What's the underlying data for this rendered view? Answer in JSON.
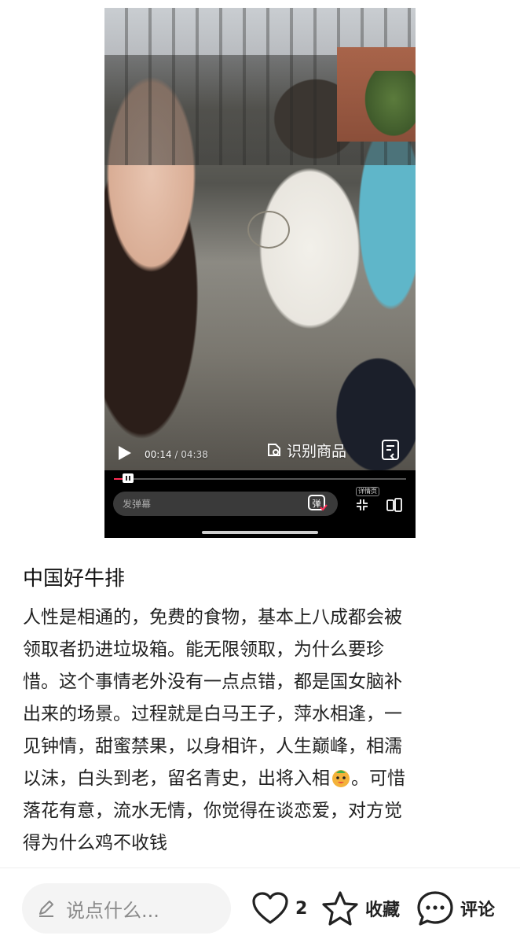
{
  "video": {
    "current_time": "00:14",
    "total_time": "/ 04:38",
    "progress": 0.05,
    "ocr_label": "识别商品",
    "danmu_placeholder": "发弹幕",
    "danmu_toggle_label": "弹",
    "detail_label": "详情页"
  },
  "post": {
    "title": "中国好牛排",
    "body_lines": [
      "人性是相通的，免费的食物，基本上八成都会被",
      "领取者扔进垃圾箱。能无限领取，为什么要珍",
      "惜。这个事情老外没有一点点错，都是国女脑补",
      "出来的场景。过程就是白马王子，萍水相逢，一",
      "见钟情，甜蜜禁果，以身相许，人生巅峰，相濡",
      "以沫，白头到老，留名青史，出将入相",
      "落花有意，流水无情，你觉得在谈恋爱，对方觉",
      "得为什么鸡不收钱"
    ],
    "line6_suffix": "。可惜"
  },
  "bottom_bar": {
    "comment_placeholder": "说点什么...",
    "like_count": "2",
    "collect_label": "收藏",
    "comment_label": "评论"
  },
  "colors": {
    "accent": "#ff2d55",
    "text": "#222222",
    "muted": "#8a8a8a"
  }
}
